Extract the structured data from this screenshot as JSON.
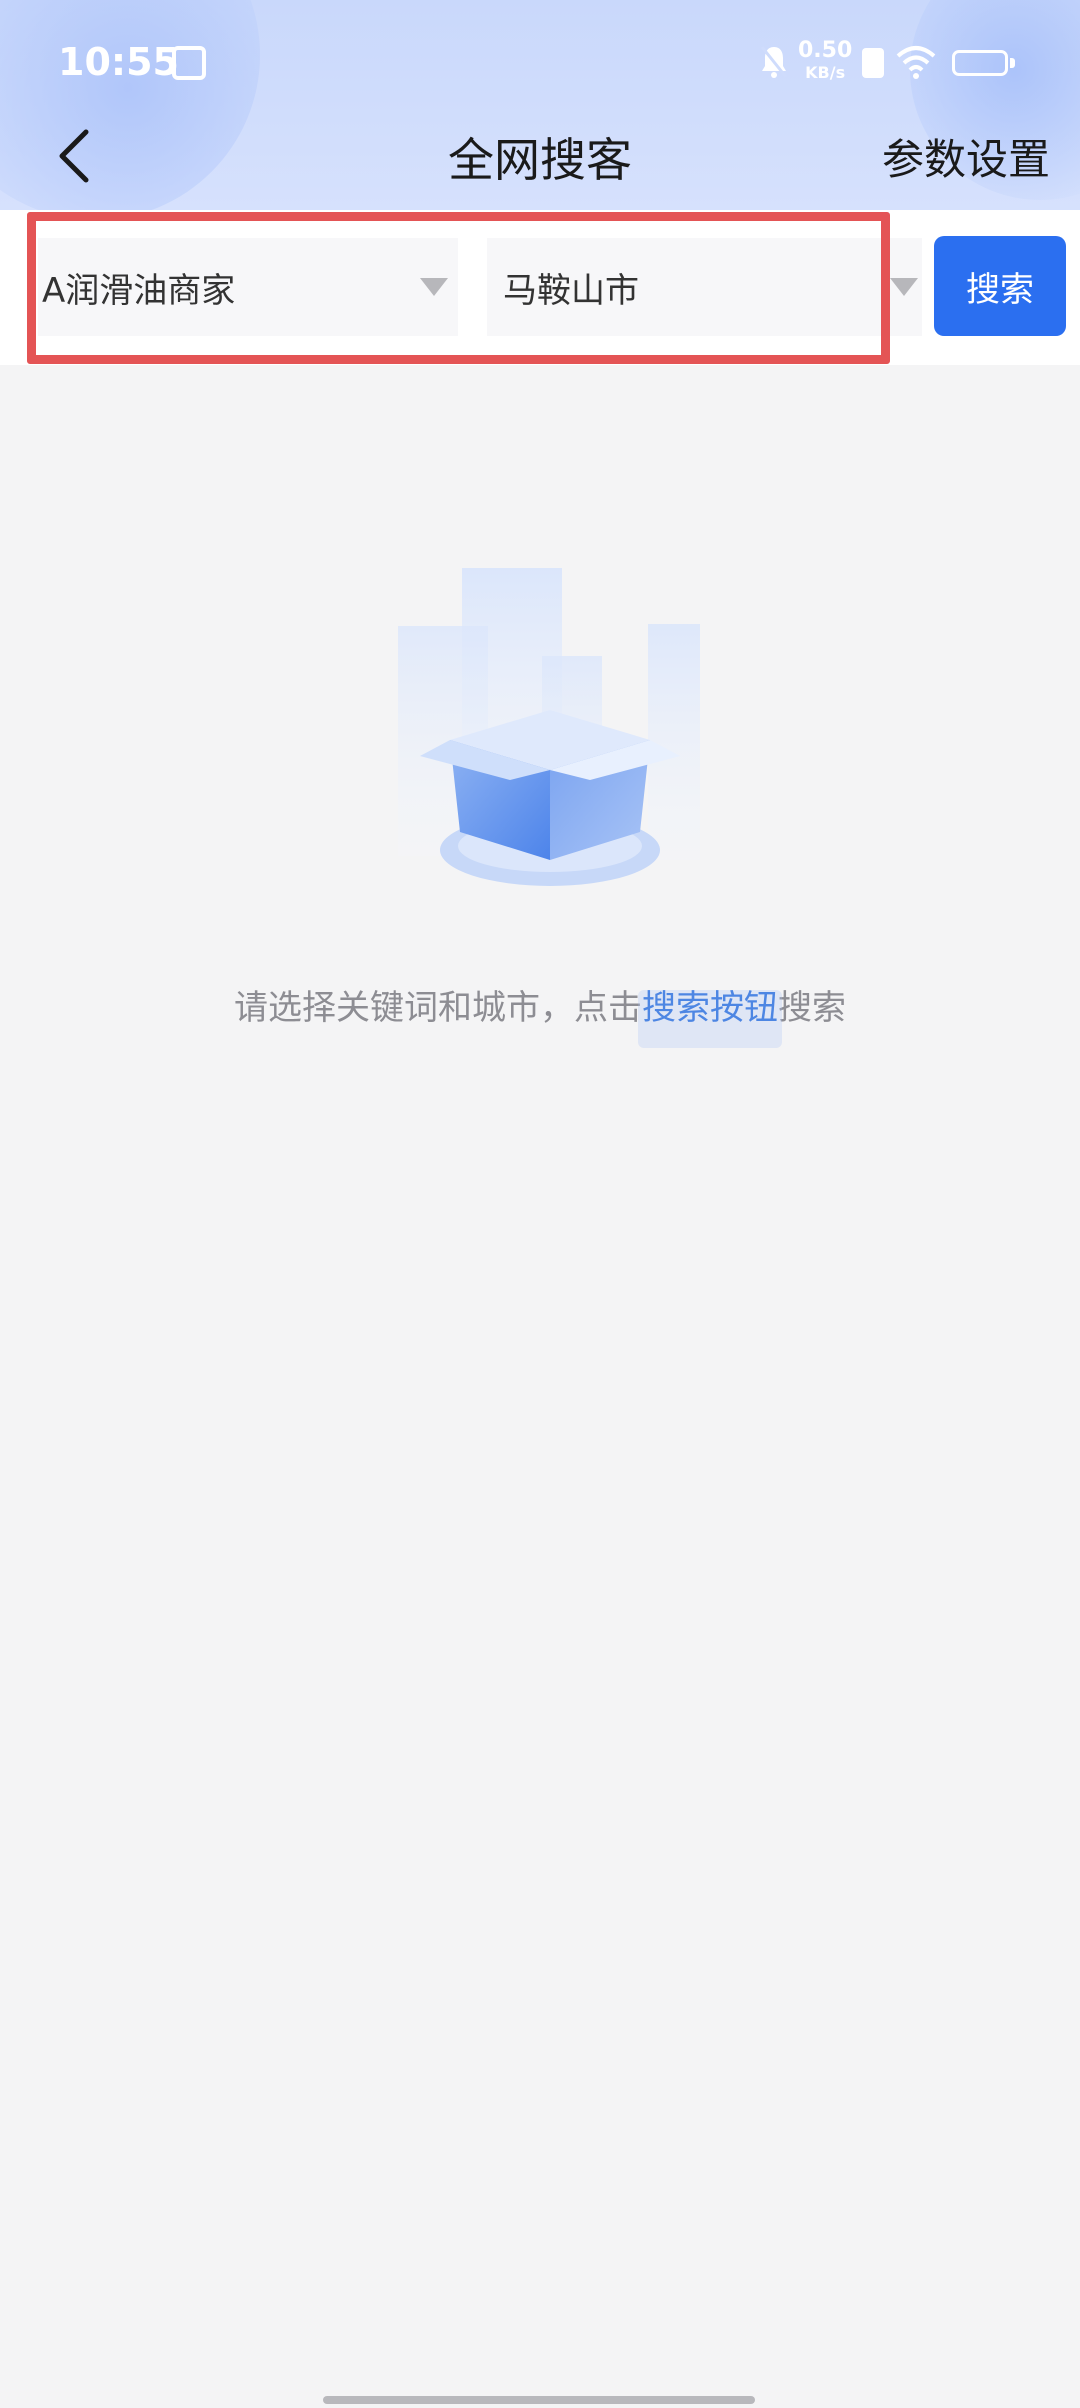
{
  "status_bar": {
    "time": "10:55",
    "net_speed_value": "0.50",
    "net_speed_unit": "KB/s",
    "icons": [
      "calendar-icon",
      "bell-muted-icon",
      "sim-icon",
      "wifi-icon",
      "battery-icon"
    ]
  },
  "header": {
    "title": "全网搜客",
    "right_link": "参数设置",
    "back_icon": "chevron-left-icon"
  },
  "search": {
    "keyword_value": "A润滑油商家",
    "city_value": "马鞍山市",
    "search_button_label": "搜索"
  },
  "empty_state": {
    "illustration": "empty-box-icon",
    "hint_prefix": "请选择关键词和城市，点击",
    "hint_link": "搜索按钮",
    "hint_suffix": "搜索"
  },
  "colors": {
    "accent": "#2b6ff0",
    "highlight_frame": "#e45455",
    "header_bg": "#d2defd",
    "page_bg": "#f4f4f5"
  }
}
